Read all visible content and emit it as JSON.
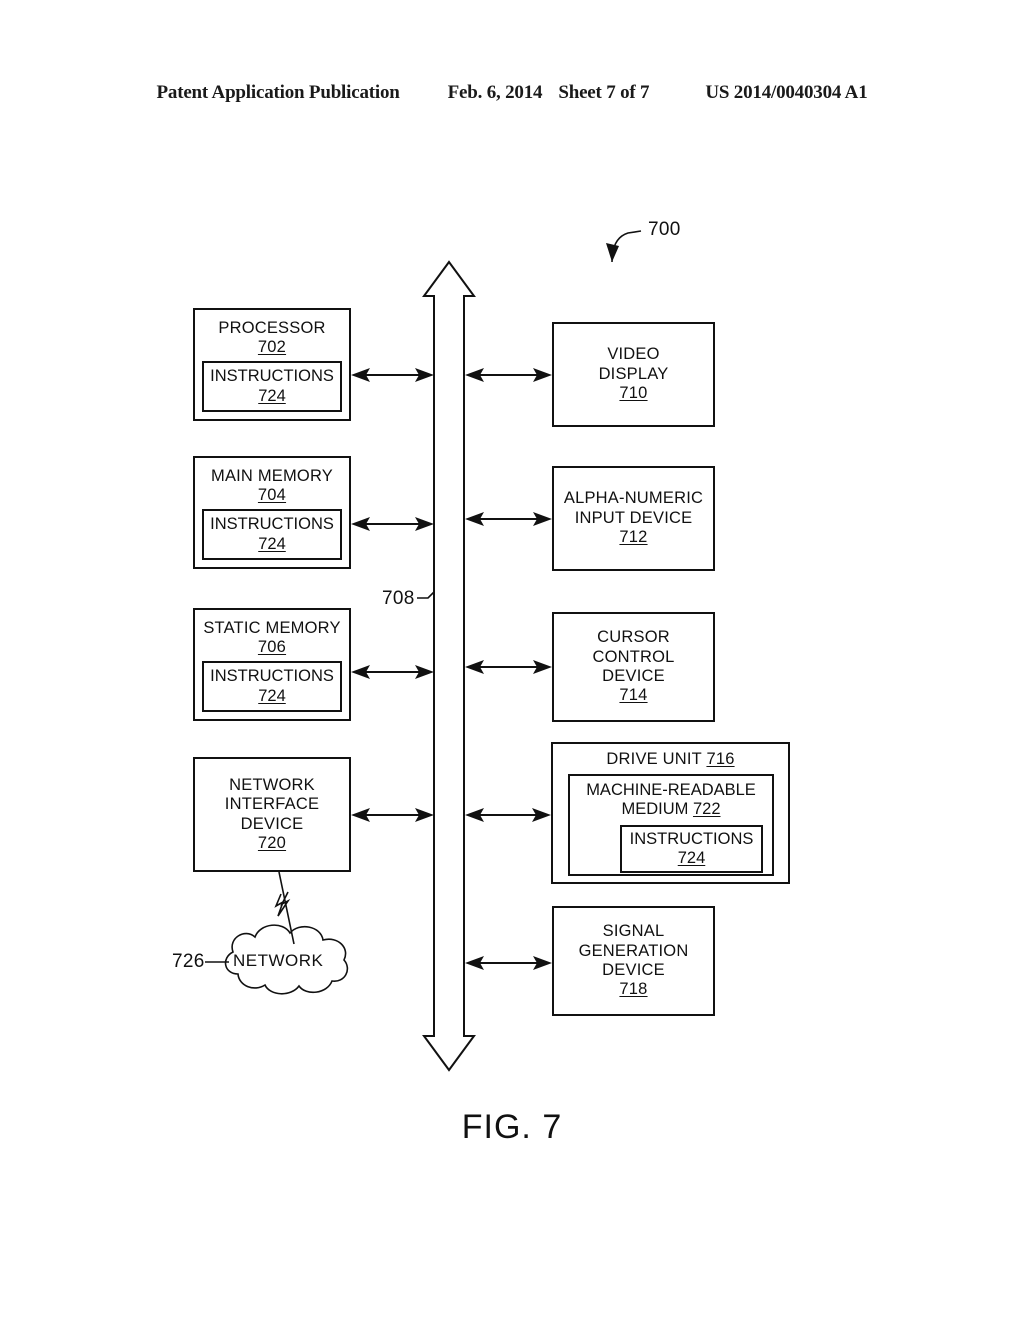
{
  "header": {
    "publication": "Patent Application Publication",
    "date": "Feb. 6, 2014",
    "sheet": "Sheet 7 of 7",
    "patent_number": "US 2014/0040304 A1"
  },
  "figure": {
    "caption": "FIG. 7",
    "system_ref": "700",
    "bus_ref": "708"
  },
  "left_column": [
    {
      "title": "PROCESSOR",
      "ref": "702",
      "inner": {
        "title": "INSTRUCTIONS",
        "ref": "724"
      }
    },
    {
      "title": "MAIN MEMORY",
      "ref": "704",
      "inner": {
        "title": "INSTRUCTIONS",
        "ref": "724"
      }
    },
    {
      "title": "STATIC MEMORY",
      "ref": "706",
      "inner": {
        "title": "INSTRUCTIONS",
        "ref": "724"
      }
    },
    {
      "title_line1": "NETWORK",
      "title_line2": "INTERFACE",
      "title_line3": "DEVICE",
      "ref": "720"
    }
  ],
  "right_column": [
    {
      "title_line1": "VIDEO",
      "title_line2": "DISPLAY",
      "ref": "710"
    },
    {
      "title_line1": "ALPHA-NUMERIC",
      "title_line2": "INPUT DEVICE",
      "ref": "712"
    },
    {
      "title_line1": "CURSOR",
      "title_line2": "CONTROL",
      "title_line3": "DEVICE",
      "ref": "714"
    },
    {
      "title": "DRIVE UNIT",
      "ref": "716",
      "inner": {
        "title_line1": "MACHINE-READABLE",
        "title_line2": "MEDIUM",
        "ref": "722",
        "inner": {
          "title": "INSTRUCTIONS",
          "ref": "724"
        }
      }
    },
    {
      "title_line1": "SIGNAL",
      "title_line2": "GENERATION",
      "title_line3": "DEVICE",
      "ref": "718"
    }
  ],
  "network": {
    "label": "NETWORK",
    "ref": "726"
  }
}
